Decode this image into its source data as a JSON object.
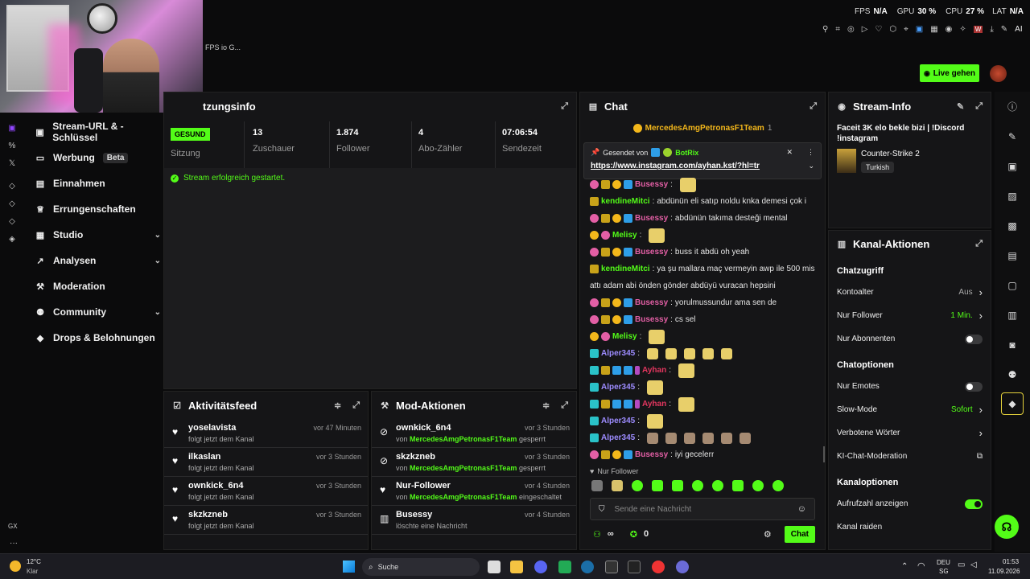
{
  "overlay": {
    "fps_label": "FPS",
    "fps_value": "N/A",
    "gpu_label": "GPU",
    "gpu_value": "30 %",
    "cpu_label": "CPU",
    "cpu_value": "27 %",
    "lat_label": "LAT",
    "lat_value": "N/A",
    "tab_fragment": "FPS io G...",
    "ai_label": "AI"
  },
  "header": {
    "go_live": "Live gehen"
  },
  "sidebar": {
    "items": [
      {
        "label": "Stream-URL & -Schlüssel",
        "icon": "monitor-icon"
      },
      {
        "label": "Werbung",
        "icon": "ad-icon",
        "badge": "Beta"
      },
      {
        "label": "Einnahmen",
        "icon": "money-icon"
      },
      {
        "label": "Errungenschaften",
        "icon": "trophy-icon"
      },
      {
        "label": "Studio",
        "icon": "studio-icon",
        "chevron": true
      },
      {
        "label": "Analysen",
        "icon": "chart-icon",
        "chevron": true
      },
      {
        "label": "Moderation",
        "icon": "hammer-icon"
      },
      {
        "label": "Community",
        "icon": "community-icon",
        "chevron": true
      },
      {
        "label": "Drops & Belohnungen",
        "icon": "drops-icon"
      }
    ],
    "gx_label": "GX"
  },
  "session": {
    "title": "tzungsinfo",
    "status_badge": "GESUND",
    "status_label": "Sitzung",
    "stats": [
      {
        "value": "13",
        "label": "Zuschauer"
      },
      {
        "value": "1.874",
        "label": "Follower"
      },
      {
        "value": "4",
        "label": "Abo-Zähler"
      },
      {
        "value": "07:06:54",
        "label": "Sendezeit"
      }
    ],
    "message": "Stream erfolgreich gestartet."
  },
  "activity": {
    "title": "Aktivitätsfeed",
    "items": [
      {
        "name": "yoselavista",
        "sub": "folgt jetzt dem Kanal",
        "time": "vor 47 Minuten"
      },
      {
        "name": "ilkaslan",
        "sub": "folgt jetzt dem Kanal",
        "time": "vor 3 Stunden"
      },
      {
        "name": "ownkick_6n4",
        "sub": "folgt jetzt dem Kanal",
        "time": "vor 3 Stunden"
      },
      {
        "name": "skzkzneb",
        "sub": "folgt jetzt dem Kanal",
        "time": "vor 3 Stunden"
      }
    ]
  },
  "mod": {
    "title": "Mod-Aktionen",
    "items": [
      {
        "name": "ownkick_6n4",
        "by": "MercedesAmgPetronasF1Team",
        "action": "gesperrt",
        "time": "vor 3 Stunden",
        "von": "von"
      },
      {
        "name": "skzkzneb",
        "by": "MercedesAmgPetronasF1Team",
        "action": "gesperrt",
        "time": "vor 3 Stunden",
        "von": "von"
      },
      {
        "name": "Nur-Follower",
        "by": "MercedesAmgPetronasF1Team",
        "action": "eingeschaltet",
        "time": "vor 4 Stunden",
        "von": "von"
      },
      {
        "name": "Busessy",
        "sub": "löschte eine Nachricht",
        "time": "vor 4 Stunden"
      }
    ]
  },
  "chat": {
    "title": "Chat",
    "top_user": "MercedesAmgPetronasF1Team",
    "top_count": "1",
    "pinned_by_label": "Gesendet von",
    "pinned_by": "BotRix",
    "pinned_link": "https://www.instagram.com/ayhan.kst/?hl=tr",
    "messages": [
      {
        "user": "Busessy",
        "color": "#e35fa5",
        "text": "",
        "badges": [
          "bp",
          "bc",
          "by",
          "bs"
        ]
      },
      {
        "user": "kendineMitci",
        "color": "#53fc18",
        "text": "abdünün eli satıp noldu knka demesi çok i",
        "badges": [
          "bc"
        ]
      },
      {
        "user": "Busessy",
        "color": "#e35fa5",
        "text": "abdünün takıma desteği mental",
        "badges": [
          "bp",
          "bc",
          "by",
          "bs"
        ]
      },
      {
        "user": "Melisy",
        "color": "#53fc18",
        "text": "",
        "badges": [
          "by",
          "bp"
        ]
      },
      {
        "user": "Busessy",
        "color": "#e35fa5",
        "text": "buss it abdü oh yeah",
        "badges": [
          "bp",
          "bc",
          "by",
          "bs"
        ]
      },
      {
        "user": "kendineMitci",
        "color": "#53fc18",
        "text": "ya şu mallara maç vermeyin awp ile 500 mis",
        "badges": [
          "bc"
        ]
      },
      {
        "user": "",
        "color": "#ddd",
        "text": "attı adam abi önden gönder abdüyü vuracan hepsini",
        "badges": []
      },
      {
        "user": "Busessy",
        "color": "#e35fa5",
        "text": "yorulmussundur ama sen de",
        "badges": [
          "bp",
          "bc",
          "by",
          "bs"
        ]
      },
      {
        "user": "Busessy",
        "color": "#e35fa5",
        "text": "cs sel",
        "badges": [
          "bp",
          "bc",
          "by",
          "bs"
        ]
      },
      {
        "user": "Melisy",
        "color": "#53fc18",
        "text": "",
        "badges": [
          "by",
          "bp"
        ]
      },
      {
        "user": "Alper345",
        "color": "#9d8cff",
        "text": "",
        "badges": [
          "bt"
        ]
      },
      {
        "user": "Ayhan",
        "color": "#e3365f",
        "text": "",
        "badges": [
          "bt",
          "bc",
          "bs",
          "bs",
          "bm"
        ]
      },
      {
        "user": "Alper345",
        "color": "#9d8cff",
        "text": "",
        "badges": [
          "bt"
        ]
      },
      {
        "user": "Ayhan",
        "color": "#e3365f",
        "text": "",
        "badges": [
          "bt",
          "bc",
          "bs",
          "bs",
          "bm"
        ]
      },
      {
        "user": "Alper345",
        "color": "#9d8cff",
        "text": "",
        "badges": [
          "bt"
        ]
      },
      {
        "user": "Alper345",
        "color": "#9d8cff",
        "text": "",
        "badges": [
          "bt"
        ]
      },
      {
        "user": "Busessy",
        "color": "#e35fa5",
        "text": "iyi gecelerr",
        "badges": [
          "bp",
          "bc",
          "by",
          "bs"
        ]
      }
    ],
    "follower_only": "Nur Follower",
    "placeholder": "Sende eine Nachricht",
    "infinity": "∞",
    "zero": "0",
    "send": "Chat"
  },
  "stream_info": {
    "title": "Stream-Info",
    "stream_title": "Faceit 3K elo bekle bizi | !Discord !instagram",
    "game": "Counter-Strike 2",
    "language": "Turkish"
  },
  "channel": {
    "title": "Kanal-Aktionen",
    "sections": [
      {
        "heading": "Chatzugriff",
        "rows": [
          {
            "label": "Kontoalter",
            "value": "Aus",
            "type": "chevron",
            "green": false
          },
          {
            "label": "Nur Follower",
            "value": "1 Min.",
            "type": "chevron",
            "green": true
          },
          {
            "label": "Nur Abonnenten",
            "type": "toggle",
            "on": false
          }
        ]
      },
      {
        "heading": "Chatoptionen",
        "rows": [
          {
            "label": "Nur Emotes",
            "type": "toggle",
            "on": false
          },
          {
            "label": "Slow-Mode",
            "value": "Sofort",
            "type": "chevron",
            "green": true
          },
          {
            "label": "Verbotene Wörter",
            "type": "chevron"
          },
          {
            "label": "KI-Chat-Moderation",
            "type": "external"
          }
        ]
      },
      {
        "heading": "Kanaloptionen",
        "rows": [
          {
            "label": "Aufrufzahl anzeigen",
            "type": "toggle",
            "on": true
          },
          {
            "label": "Kanal raiden",
            "type": "none"
          }
        ]
      }
    ]
  },
  "taskbar": {
    "temp": "12°C",
    "weather": "Klar",
    "search": "Suche",
    "lang1": "DEU",
    "lang2": "SG",
    "time": "01:53",
    "date": "11.09.2026"
  },
  "colors": {
    "accent": "#53fc18",
    "panel": "#151517",
    "bg": "#0b0b0c"
  }
}
